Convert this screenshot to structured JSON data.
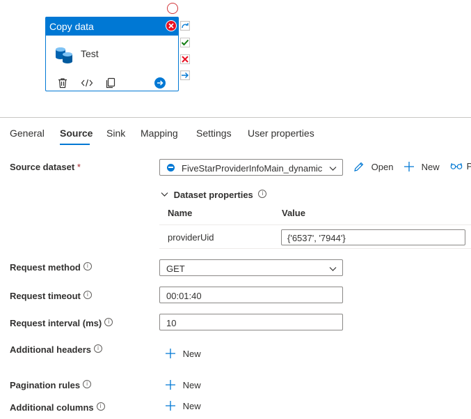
{
  "canvas": {
    "activity": {
      "title": "Copy data",
      "name": "Test",
      "icons": [
        "close-icon",
        "copy-data-icon",
        "delete-icon",
        "code-icon",
        "clone-icon",
        "run-arrow-icon"
      ]
    },
    "handles": [
      "redo-icon",
      "success-check-icon",
      "failure-x-icon",
      "completion-arrow-icon"
    ]
  },
  "tabs": [
    {
      "label": "General"
    },
    {
      "label": "Source"
    },
    {
      "label": "Sink"
    },
    {
      "label": "Mapping"
    },
    {
      "label": "Settings"
    },
    {
      "label": "User properties"
    }
  ],
  "source": {
    "dataset_label": "Source dataset",
    "required_mark": "*",
    "dataset_value": "FiveStarProviderInfoMain_dynamic",
    "open_label": "Open",
    "new_label": "New",
    "preview_label": "P",
    "dataset_properties": {
      "title": "Dataset properties",
      "col_name": "Name",
      "col_value": "Value",
      "rows": [
        {
          "name": "providerUid",
          "value": "{'6537', '7944'}"
        }
      ]
    },
    "request_method": {
      "label": "Request method",
      "value": "GET"
    },
    "request_timeout": {
      "label": "Request timeout",
      "value": "00:01:40"
    },
    "request_interval": {
      "label": "Request interval (ms)",
      "value": "10"
    },
    "additional_headers": {
      "label": "Additional headers",
      "new_label": "New"
    },
    "pagination_rules": {
      "label": "Pagination rules",
      "new_label": "New"
    },
    "additional_columns": {
      "label": "Additional columns",
      "new_label": "New"
    }
  },
  "colors": {
    "accent": "#0078d4",
    "error": "#e81123",
    "success": "#107c10"
  }
}
